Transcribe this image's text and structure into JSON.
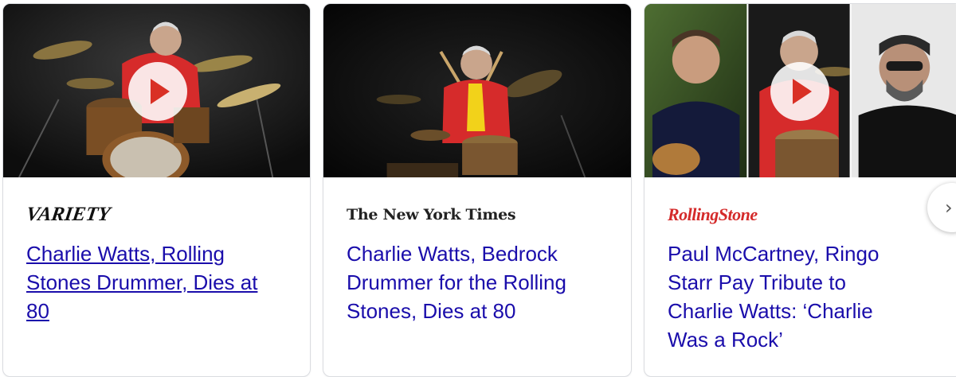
{
  "cards": [
    {
      "source": "VARIETY",
      "headline": "Charlie Watts, Rolling Stones Drummer, Dies at 80",
      "has_video": true
    },
    {
      "source": "The New York Times",
      "headline": "Charlie Watts, Bedrock Drummer for the Rolling Stones, Dies at 80",
      "has_video": false
    },
    {
      "source": "RollingStone",
      "headline": "Paul McCartney, Ringo Starr Pay Tribute to Charlie Watts: ‘Charlie Was a Rock’",
      "has_video": true
    }
  ],
  "icons": {
    "play": "play-icon",
    "next": "chevron-right-icon"
  },
  "colors": {
    "headline_link": "#1a0dab",
    "play_triangle": "#d93025",
    "rolling_stone_brand": "#d42a2a",
    "card_border": "#dadce0"
  }
}
